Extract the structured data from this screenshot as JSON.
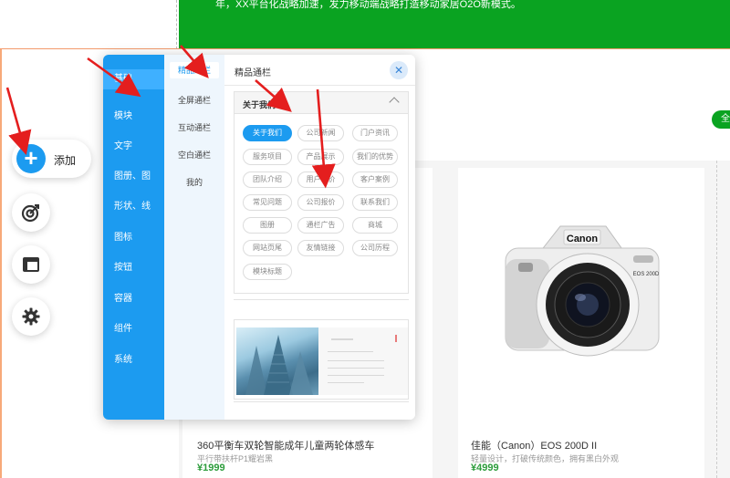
{
  "banner": {
    "text": "年，XX平台化战略加速，发力移动端战略打造移动家居O2O新模式。"
  },
  "right_pill": {
    "label": "全"
  },
  "tools": {
    "add_label": "添加"
  },
  "panel": {
    "categories": [
      "基础",
      "模块",
      "文字",
      "图册、图",
      "形状、线",
      "图标",
      "按钮",
      "容器",
      "组件",
      "系统"
    ],
    "subcategories": [
      "精品通栏",
      "全屏通栏",
      "互动通栏",
      "空白通栏",
      "我的"
    ],
    "content_title": "精品通栏",
    "close_symbol": "✕",
    "section_title": "关于我们",
    "chips": [
      [
        "关于我们",
        "公司新闻",
        "门户资讯"
      ],
      [
        "服务项目",
        "产品展示",
        "我们的优势"
      ],
      [
        "团队介绍",
        "用户评价",
        "客户案例"
      ],
      [
        "常见问题",
        "公司报价",
        "联系我们"
      ],
      [
        "图册",
        "通栏广告",
        "商城"
      ],
      [
        "网站页尾",
        "友情链接",
        "公司历程"
      ],
      [
        "模块标题"
      ]
    ]
  },
  "products": [
    {
      "title": "360平衡车双轮智能成年儿童两轮体感车",
      "subtitle": "平行带扶杆P1耀岩黑",
      "price": "¥1999"
    },
    {
      "title": "佳能（Canon）EOS 200D II",
      "subtitle": "轻量设计，打破传统颜色，拥有黑白外观",
      "price": "¥4999",
      "brand": "Canon",
      "model_mark": "EOS 200D"
    }
  ]
}
